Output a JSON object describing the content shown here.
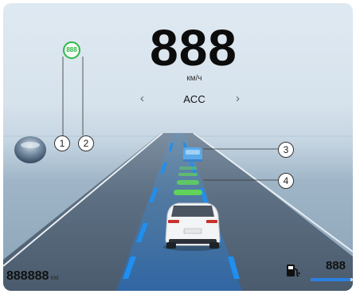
{
  "speed": {
    "value": "888",
    "unit": "км/ч"
  },
  "cruise": {
    "mode": "ACC",
    "prev_icon": "chevron-left-icon",
    "next_icon": "chevron-right-icon"
  },
  "speed_limit": {
    "value": "888",
    "color": "#2fb84a"
  },
  "callouts": [
    "1",
    "2",
    "3",
    "4"
  ],
  "odometer": {
    "value": "888888",
    "unit": "км"
  },
  "fuel": {
    "value": "888",
    "icon": "fuel-pump-icon",
    "level": 0.95,
    "color": "#2a7fe0"
  },
  "colors": {
    "lane_marker": "#1f8ff0",
    "distance_bar": "#5fd35a",
    "lead_vehicle": "#5aa9ea"
  }
}
